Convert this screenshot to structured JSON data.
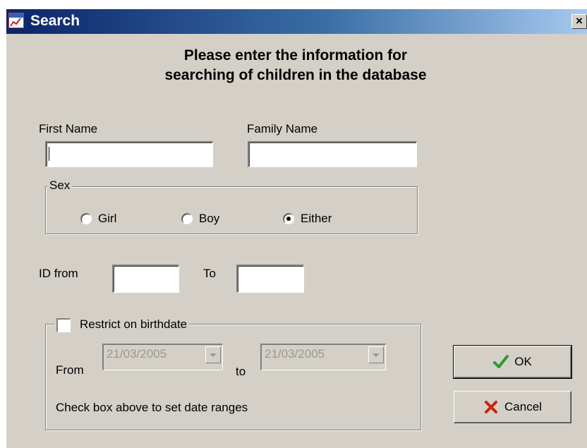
{
  "window": {
    "title": "Search",
    "close_label": "×",
    "app_icon": "app-logo-icon"
  },
  "heading": {
    "line1": "Please enter the information for",
    "line2": "searching of children in the database"
  },
  "name_fields": {
    "first_name_label": "First Name",
    "first_name_value": "",
    "family_name_label": "Family Name",
    "family_name_value": ""
  },
  "sex": {
    "legend": "Sex",
    "options": [
      "Girl",
      "Boy",
      "Either"
    ],
    "selected": "Either"
  },
  "id_range": {
    "from_label": "ID from",
    "to_label": "To",
    "from_value": "",
    "to_value": ""
  },
  "birthdate": {
    "checkbox_label": "Restrict on birthdate",
    "checked": false,
    "from_label": "From",
    "from_value": "21/03/2005",
    "to_label": "to",
    "to_value": "21/03/2005",
    "hint": "Check box above to set date ranges"
  },
  "buttons": {
    "ok_label": "OK",
    "cancel_label": "Cancel",
    "ok_icon": "checkmark-icon",
    "cancel_icon": "red-x-icon",
    "ok_icon_color": "#2e9a2e",
    "cancel_icon_color": "#d02010"
  }
}
